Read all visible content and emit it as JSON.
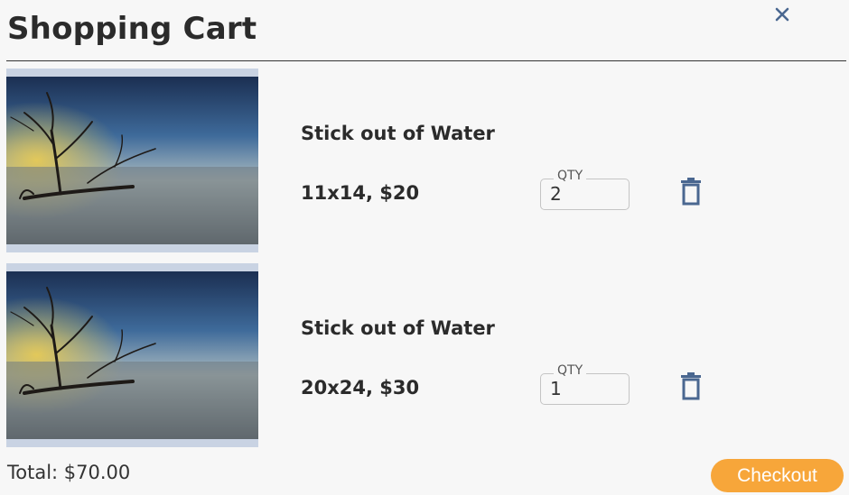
{
  "header": {
    "title": "Shopping Cart",
    "close_icon": "close-icon"
  },
  "cart": {
    "items": [
      {
        "name": "Stick out of Water",
        "option": "11x14, $20",
        "qty_label": "QTY",
        "qty": "2"
      },
      {
        "name": "Stick out of Water",
        "option": "20x24, $30",
        "qty_label": "QTY",
        "qty": "1"
      }
    ]
  },
  "footer": {
    "total": "Total: $70.00",
    "checkout_label": "Checkout"
  },
  "colors": {
    "accent": "#f7a63a",
    "icon": "#4a6790"
  }
}
